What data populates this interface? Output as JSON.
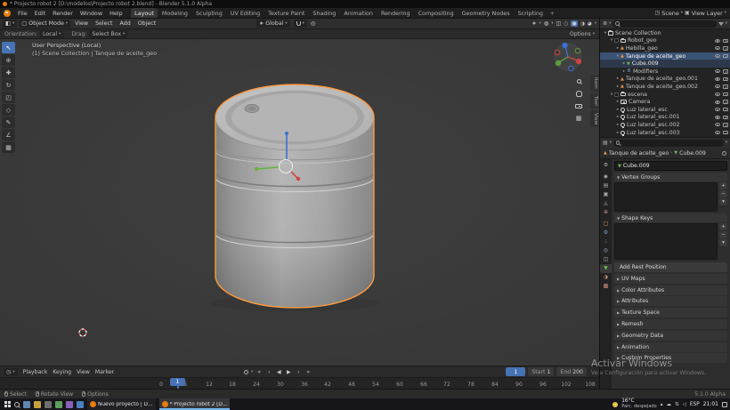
{
  "titlebar": {
    "title": "* Projecto robot 2 [D:\\modelos\\Projecto robot 2.blend] - Blender 5.1.0 Alpha"
  },
  "topbar": {
    "menus": [
      "File",
      "Edit",
      "Render",
      "Window",
      "Help"
    ],
    "tabs": [
      "Layout",
      "Modeling",
      "Sculpting",
      "UV Editing",
      "Texture Paint",
      "Shading",
      "Animation",
      "Rendering",
      "Compositing",
      "Geometry Nodes",
      "Scripting"
    ],
    "add_tab": "+",
    "scene_label": "Scene",
    "view_layer_label": "View Layer"
  },
  "viewport_header": {
    "mode": "Object Mode",
    "menus": [
      "View",
      "Select",
      "Add",
      "Object"
    ],
    "orientation": "Global"
  },
  "tool_settings": {
    "orientation_label": "Orientation:",
    "orientation_value": "Local",
    "drag_label": "Drag:",
    "drag_value": "Select Box",
    "options_label": "Options"
  },
  "viewport": {
    "overlay_line1": "User Perspective (Local)",
    "overlay_line2": "(1) Scene Collection | Tanque de aceite_geo",
    "sidebar_tabs": [
      "Item",
      "Tool",
      "View"
    ]
  },
  "outliner": {
    "items": [
      {
        "label": "Scene Collection"
      },
      {
        "label": "Robot_geo"
      },
      {
        "label": "Hebilla_geo"
      },
      {
        "label": "Tanque de aceite_geo"
      },
      {
        "label": "Cube.009"
      },
      {
        "label": "Modifiers"
      },
      {
        "label": "Tanque de aceite_geo.001"
      },
      {
        "label": "Tanque de aceite_geo.002"
      },
      {
        "label": "escena"
      },
      {
        "label": "Camera"
      },
      {
        "label": "Luz lateral_esc"
      },
      {
        "label": "Luz lateral_esc.001"
      },
      {
        "label": "Luz lateral_esc.002"
      },
      {
        "label": "Luz lateral_esc.003"
      }
    ]
  },
  "properties": {
    "breadcrumb_object": "Tanque de aceite_geo",
    "breadcrumb_data": "Cube.009",
    "name_field": "Cube.009",
    "panels_open": [
      "Vertex Groups",
      "Shape Keys"
    ],
    "rest_button": "Add Rest Position",
    "panels_collapsed": [
      "UV Maps",
      "Color Attributes",
      "Attributes",
      "Texture Space",
      "Remesh",
      "Geometry Data",
      "Animation",
      "Custom Properties"
    ]
  },
  "timeline": {
    "menus": [
      "Playback",
      "Keying",
      "View",
      "Marker"
    ],
    "current_frame": "1",
    "start_label": "Start",
    "start_value": "1",
    "end_label": "End",
    "end_value": "200",
    "ruler": [
      "0",
      "6",
      "12",
      "18",
      "24",
      "30",
      "36",
      "42",
      "48",
      "54",
      "60",
      "66",
      "72",
      "78",
      "84",
      "90",
      "96",
      "102",
      "108"
    ],
    "playhead": "1"
  },
  "statusbar": {
    "hints": [
      "Select",
      "Rotate View",
      "Options"
    ],
    "version": "5.1.0 Alpha"
  },
  "taskbar": {
    "window1": "Nuevo proyecto | D...",
    "window2": "* Projecto robot 2 [D...",
    "weather_temp": "16°C",
    "weather_desc": "Parc. despejado",
    "lang": "ESP",
    "time": "21:01"
  },
  "watermark": {
    "line1": "Activar Windows",
    "line2": "Ve a Configuración para activar Windows."
  },
  "colors": {
    "accent": "#4772b3",
    "blender_orange": "#e87d0d",
    "selection_outline": "#ff9a3d",
    "axis_x": "#d04545",
    "axis_y": "#65b33e",
    "axis_z": "#3b6fd0"
  }
}
